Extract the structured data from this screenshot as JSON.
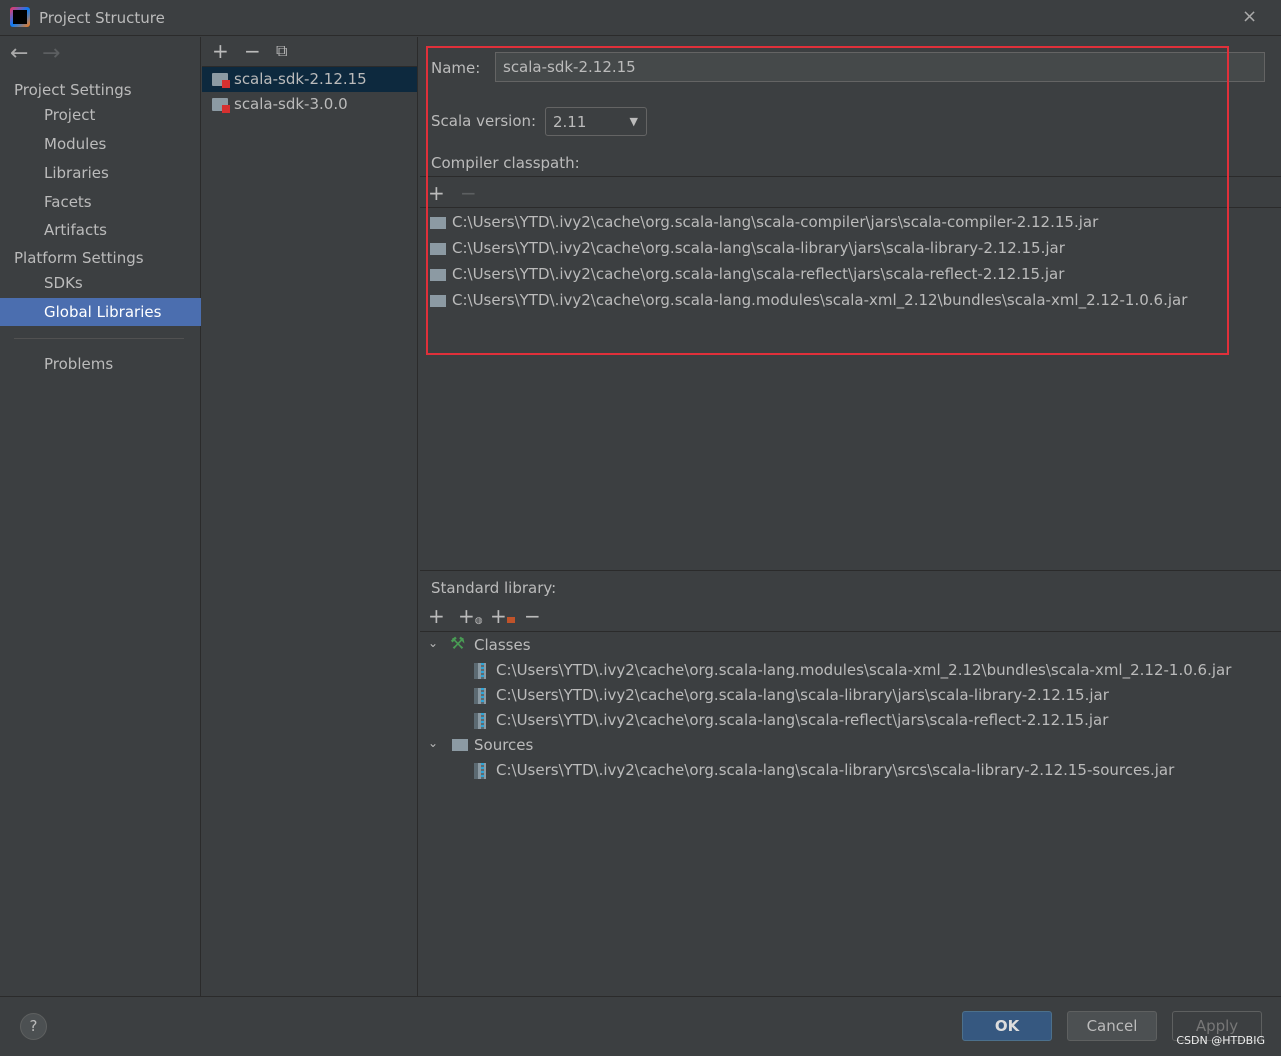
{
  "window": {
    "title": "Project Structure",
    "close_icon": "×"
  },
  "sidebar": {
    "back": "←",
    "forward": "→",
    "project_settings": "Project Settings",
    "platform_settings": "Platform Settings",
    "items": [
      "Project",
      "Modules",
      "Libraries",
      "Facets",
      "Artifacts",
      "SDKs",
      "Global Libraries",
      "Problems"
    ],
    "selected": "Global Libraries"
  },
  "list": {
    "add": "+",
    "remove": "−",
    "copy": "⧉",
    "items": [
      "scala-sdk-2.12.15",
      "scala-sdk-3.0.0"
    ]
  },
  "detail": {
    "name_label": "Name:",
    "name_value": "scala-sdk-2.12.15",
    "version_label": "Scala version:",
    "version_value": "2.11",
    "compiler_label": "Compiler classpath:",
    "classpath": [
      "C:\\Users\\YTD\\.ivy2\\cache\\org.scala-lang\\scala-compiler\\jars\\scala-compiler-2.12.15.jar",
      "C:\\Users\\YTD\\.ivy2\\cache\\org.scala-lang\\scala-library\\jars\\scala-library-2.12.15.jar",
      "C:\\Users\\YTD\\.ivy2\\cache\\org.scala-lang\\scala-reflect\\jars\\scala-reflect-2.12.15.jar",
      "C:\\Users\\YTD\\.ivy2\\cache\\org.scala-lang.modules\\scala-xml_2.12\\bundles\\scala-xml_2.12-1.0.6.jar"
    ],
    "std_label": "Standard library:",
    "classes_label": "Classes",
    "sources_label": "Sources",
    "classes": [
      "C:\\Users\\YTD\\.ivy2\\cache\\org.scala-lang.modules\\scala-xml_2.12\\bundles\\scala-xml_2.12-1.0.6.jar",
      "C:\\Users\\YTD\\.ivy2\\cache\\org.scala-lang\\scala-library\\jars\\scala-library-2.12.15.jar",
      "C:\\Users\\YTD\\.ivy2\\cache\\org.scala-lang\\scala-reflect\\jars\\scala-reflect-2.12.15.jar"
    ],
    "sources": [
      "C:\\Users\\YTD\\.ivy2\\cache\\org.scala-lang\\scala-library\\srcs\\scala-library-2.12.15-sources.jar"
    ]
  },
  "footer": {
    "help": "?",
    "ok": "OK",
    "cancel": "Cancel",
    "apply": "Apply",
    "watermark": "CSDN @HTDBIG"
  },
  "colors": {
    "highlight_box": "#e0303a",
    "selection": "#4b6eaf",
    "ok_button": "#365880"
  }
}
